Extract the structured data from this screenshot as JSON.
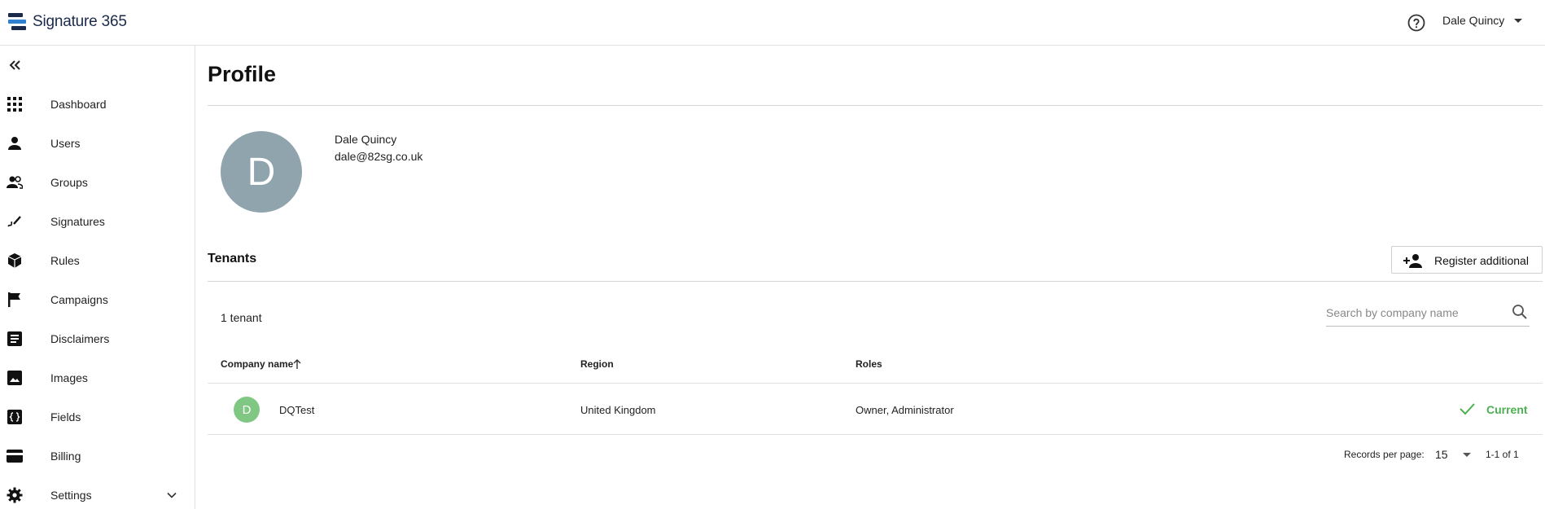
{
  "app": {
    "name": "Signature 365"
  },
  "header": {
    "user_name": "Dale Quincy",
    "help_icon": "help-circle-icon"
  },
  "sidebar": {
    "items": [
      {
        "label": "Dashboard",
        "icon": "grid-icon"
      },
      {
        "label": "Users",
        "icon": "person-icon"
      },
      {
        "label": "Groups",
        "icon": "people-icon"
      },
      {
        "label": "Signatures",
        "icon": "signature-icon"
      },
      {
        "label": "Rules",
        "icon": "cube-icon"
      },
      {
        "label": "Campaigns",
        "icon": "flag-icon"
      },
      {
        "label": "Disclaimers",
        "icon": "document-icon"
      },
      {
        "label": "Images",
        "icon": "image-icon"
      },
      {
        "label": "Fields",
        "icon": "braces-icon"
      },
      {
        "label": "Billing",
        "icon": "credit-card-icon"
      },
      {
        "label": "Settings",
        "icon": "gear-icon"
      }
    ]
  },
  "main": {
    "title": "Profile",
    "profile": {
      "avatar_letter": "D",
      "name": "Dale Quincy",
      "email": "dale@82sg.co.uk"
    },
    "tenants": {
      "title": "Tenants",
      "register_label": "Register additional",
      "count_text": "1 tenant",
      "search_placeholder": "Search by company name",
      "columns": [
        "Company name",
        "Region",
        "Roles"
      ],
      "rows": [
        {
          "avatar_letter": "D",
          "company": "DQTest",
          "region": "United Kingdom",
          "roles": "Owner, Administrator",
          "status": "Current"
        }
      ],
      "pager": {
        "label": "Records per page:",
        "per_page": "15",
        "range": "1-1 of 1"
      }
    }
  },
  "colors": {
    "avatar": "#90a4ae",
    "tenant_avatar": "#81c784",
    "status": "#4caf50",
    "brand_dark": "#1b2a4a",
    "brand_blue": "#2f80d1"
  }
}
